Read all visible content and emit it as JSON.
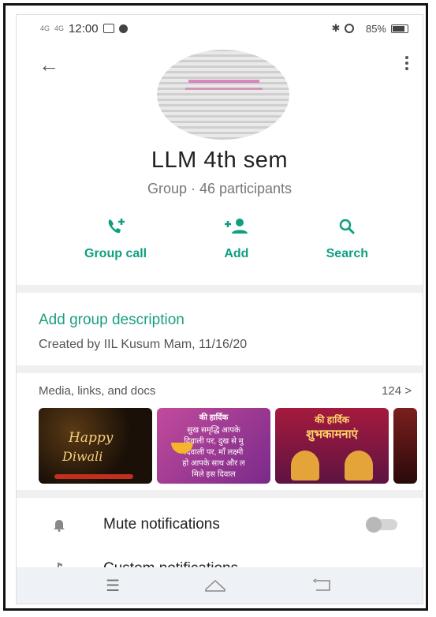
{
  "status_bar": {
    "sim1": "4G",
    "sim2": "4G",
    "time": "12:00",
    "battery": "85%"
  },
  "group": {
    "name": "LLM 4th sem",
    "subtitle": "Group · 46 participants"
  },
  "actions": [
    {
      "label": "Group call",
      "icon": "group-call-icon"
    },
    {
      "label": "Add",
      "icon": "add-person-icon"
    },
    {
      "label": "Search",
      "icon": "search-icon"
    }
  ],
  "description": {
    "add_label": "Add group description",
    "created": "Created by IIL Kusum Mam, 11/16/20"
  },
  "media": {
    "heading": "Media, links, and docs",
    "count": "124 >",
    "thumbs": [
      {
        "lines": [
          "Happy",
          "Diwali"
        ]
      },
      {
        "lines": [
          "की हार्दिक",
          "सुख समृद्धि आपके",
          "दिवाली पर, दुख से मु",
          "दिवाली पर, माँ लक्ष्मी",
          "हो आपके साथ और ल",
          "मिले इस दिवाल"
        ]
      },
      {
        "lines": [
          "की हार्दिक",
          "शुभकामनाएं"
        ]
      }
    ]
  },
  "settings": {
    "mute": "Mute notifications",
    "custom": "Custom notifications"
  },
  "colors": {
    "accent": "#0e9f80",
    "text": "#222222"
  }
}
